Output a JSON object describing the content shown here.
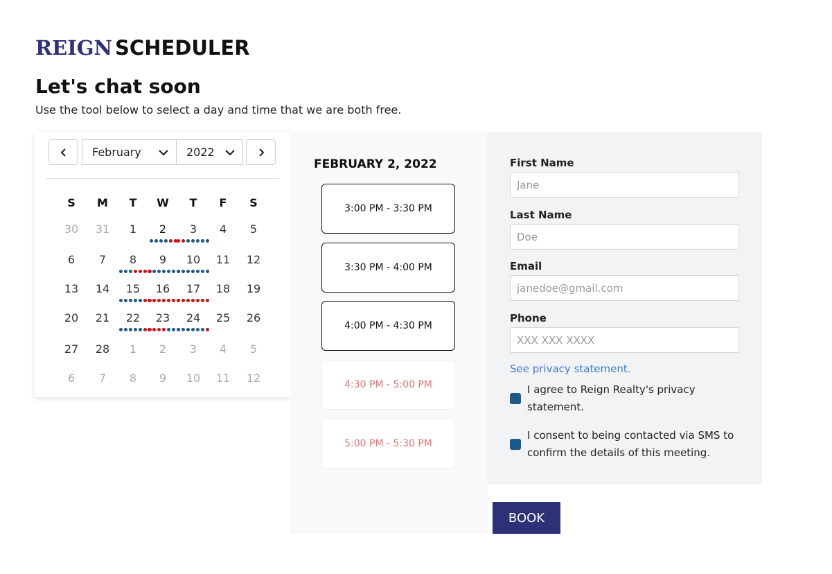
{
  "brand": {
    "name_part1": "REIGN",
    "name_part2": "SCHEDULER"
  },
  "heading": {
    "title": "Let's chat soon",
    "subtitle": "Use the tool below to select a day and time that we are both free."
  },
  "calendar": {
    "month": "February",
    "year": "2022",
    "weekdays": [
      "S",
      "M",
      "T",
      "W",
      "T",
      "F",
      "S"
    ],
    "weeks": [
      [
        "30",
        "31",
        "1",
        "2",
        "3",
        "4",
        "5"
      ],
      [
        "6",
        "7",
        "8",
        "9",
        "10",
        "11",
        "12"
      ],
      [
        "13",
        "14",
        "15",
        "16",
        "17",
        "18",
        "19"
      ],
      [
        "20",
        "21",
        "22",
        "23",
        "24",
        "25",
        "26"
      ],
      [
        "27",
        "28",
        "1",
        "2",
        "3",
        "4",
        "5"
      ],
      [
        "6",
        "7",
        "8",
        "9",
        "10",
        "11",
        "12"
      ]
    ],
    "selected_day": "2"
  },
  "slots": {
    "date_title": "FEBRUARY 2, 2022",
    "items": [
      {
        "label": "3:00 PM - 3:30 PM",
        "available": true
      },
      {
        "label": "3:30 PM - 4:00 PM",
        "available": true
      },
      {
        "label": "4:00 PM - 4:30 PM",
        "available": true
      },
      {
        "label": "4:30 PM - 5:00 PM",
        "available": false
      },
      {
        "label": "5:00 PM - 5:30 PM",
        "available": false
      }
    ]
  },
  "form": {
    "first_name_label": "First Name",
    "first_name_placeholder": "Jane",
    "last_name_label": "Last Name",
    "last_name_placeholder": "Doe",
    "email_label": "Email",
    "email_placeholder": "janedoe@gmail.com",
    "phone_label": "Phone",
    "phone_placeholder": "XXX XXX XXXX",
    "privacy_link": "See privacy statement.",
    "agree_privacy": "I agree to Reign Realty's privacy statement.",
    "consent_sms": "I consent to being contacted via SMS to confirm the details of this meeting."
  },
  "book_label": "BOOK",
  "colors": {
    "brand": "#2c3275",
    "dot_blue": "#1d5a8c",
    "dot_red": "#d01010",
    "unavailable_text": "#e57373",
    "link": "#3a7bd5"
  },
  "icons": {
    "prev": "chevron-left-icon",
    "next": "chevron-right-icon",
    "dropdown": "chevron-down-icon"
  }
}
